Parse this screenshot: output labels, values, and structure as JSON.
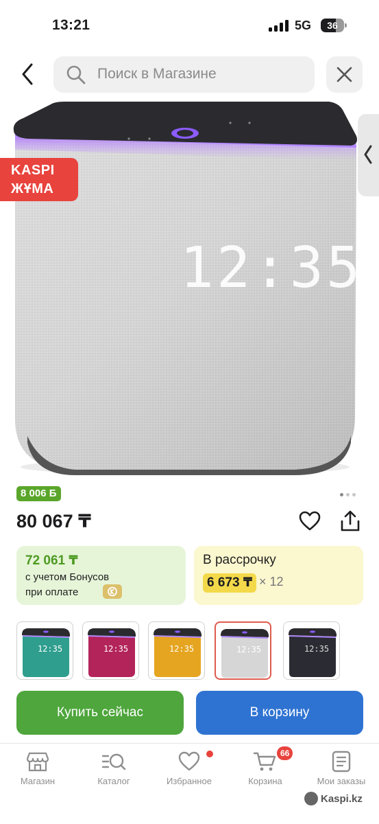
{
  "status_bar": {
    "time": "13:21",
    "network": "5G",
    "battery": "36"
  },
  "search": {
    "placeholder": "Поиск в Магазине"
  },
  "promo": {
    "line1": "KASPI",
    "line2": "ЖҰМА"
  },
  "product": {
    "display_time": "12:35",
    "bonus_badge": "8 006 Б",
    "price": "80 067 ₸"
  },
  "bonus_card": {
    "amount": "72 061 ₸",
    "line1": "с учетом Бонусов",
    "line2": "при оплате"
  },
  "installment_card": {
    "title": "В рассрочку",
    "monthly": "6 673 ₸",
    "multiplier": "× 12"
  },
  "variants": [
    {
      "name": "teal",
      "color": "#2f9e8e",
      "time": "12:35"
    },
    {
      "name": "magenta",
      "color": "#b3245a",
      "time": "12:35"
    },
    {
      "name": "yellow",
      "color": "#e5a520",
      "time": "12:35"
    },
    {
      "name": "light-grey",
      "color": "#d6d6d6",
      "time": "12:35",
      "selected": true
    },
    {
      "name": "black",
      "color": "#2b2c33",
      "time": "12:35"
    }
  ],
  "actions": {
    "buy_now": "Купить сейчас",
    "to_cart": "В корзину"
  },
  "tabbar": [
    {
      "label": "Магазин",
      "icon": "store-icon"
    },
    {
      "label": "Каталог",
      "icon": "catalog-search-icon"
    },
    {
      "label": "Избранное",
      "icon": "heart-icon"
    },
    {
      "label": "Корзина",
      "icon": "cart-icon",
      "badge": "66"
    },
    {
      "label": "Мои заказы",
      "icon": "orders-icon"
    }
  ],
  "watermark": "Kaspi.kz",
  "colors": {
    "green": "#4ea63c",
    "blue": "#2f73d2",
    "red": "#e8433d",
    "bonus_green": "#5aa62b"
  }
}
